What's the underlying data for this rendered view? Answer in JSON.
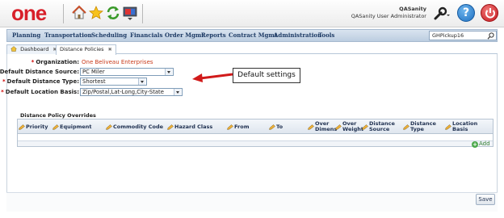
{
  "header": {
    "logo_text": "one",
    "user_name": "QASanity",
    "user_role": "QASanity User Administrator",
    "brand_color": "#d8202a"
  },
  "nav": {
    "items": [
      "Planning",
      "Transportation",
      "Scheduling",
      "Financials",
      "Order Mgmt",
      "Reports",
      "Contract Mgmt",
      "Administration",
      "Tools"
    ],
    "search_value": "GHPickup16"
  },
  "tabs": [
    {
      "label": "Dashboard",
      "close": "✖"
    },
    {
      "label": "Distance Policies",
      "close": "✖"
    }
  ],
  "form": {
    "organization_label": "Organization:",
    "organization_value": "One Beliveau Enterprises",
    "distance_source_label": "Default Distance Source:",
    "distance_source_value": "PC Miler",
    "distance_type_label": "Default Distance Type:",
    "distance_type_value": "Shortest",
    "location_basis_label": "Default Location Basis:",
    "location_basis_value": "Zip/Postal,Lat-Long,City-State",
    "required_mark": "*"
  },
  "callout": {
    "text": "Default settings"
  },
  "overrides": {
    "title": "Distance Policy Overrides",
    "columns": [
      {
        "line1": "Priority",
        "line2": ""
      },
      {
        "line1": "Equipment",
        "line2": ""
      },
      {
        "line1": "Commodity Code",
        "line2": ""
      },
      {
        "line1": "Hazard Class",
        "line2": ""
      },
      {
        "line1": "From",
        "line2": ""
      },
      {
        "line1": "To",
        "line2": ""
      },
      {
        "line1": "Over",
        "line2": "Dimens"
      },
      {
        "line1": "Over",
        "line2": "Weight"
      },
      {
        "line1": "Distance",
        "line2": "Source"
      },
      {
        "line1": "Distance",
        "line2": "Type"
      },
      {
        "line1": "Location",
        "line2": "Basis"
      }
    ],
    "add_label": "Add"
  },
  "footer": {
    "save_label": "Save"
  }
}
